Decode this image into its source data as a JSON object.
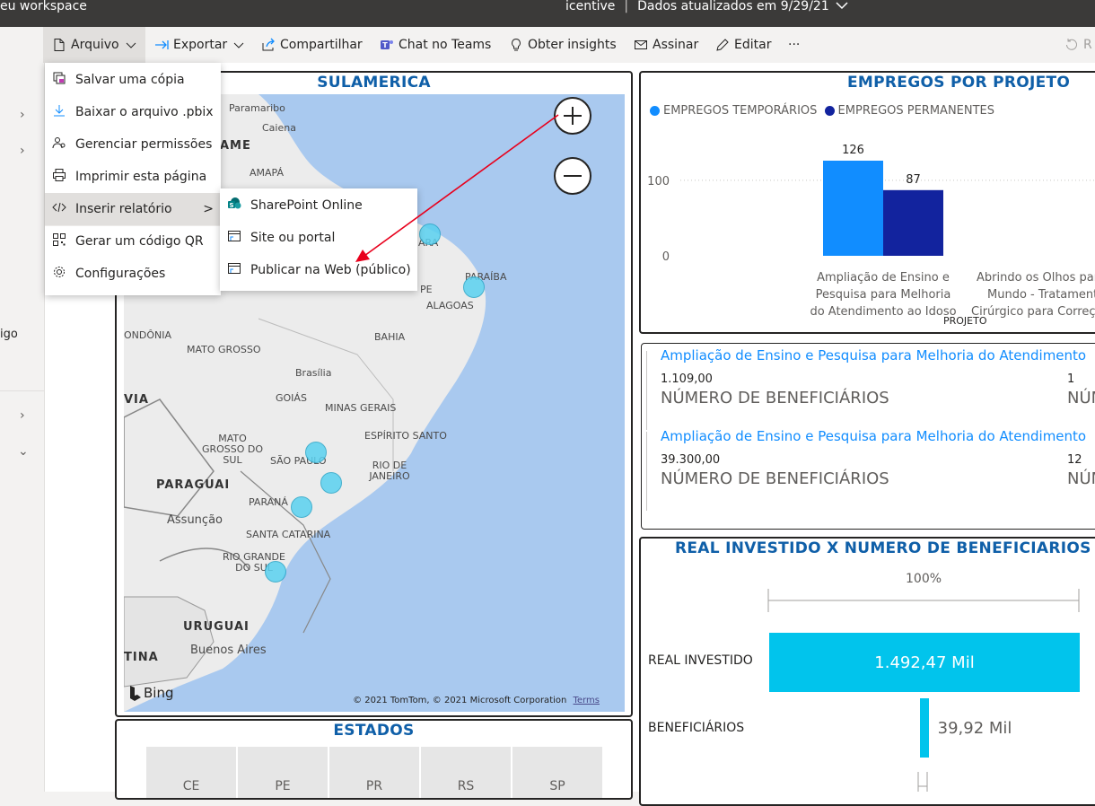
{
  "topbar": {
    "workspace": "eu workspace",
    "report_name": "icentive",
    "separator": "|",
    "updated": "Dados atualizados em 9/29/21",
    "chevron": "chevron-down-icon"
  },
  "toolbar": {
    "arquivo": "Arquivo",
    "exportar": "Exportar",
    "compartilhar": "Compartilhar",
    "teams": "Chat no Teams",
    "insights": "Obter insights",
    "assinar": "Assinar",
    "editar": "Editar",
    "more": "···",
    "reset_fragment": "R"
  },
  "left_pane": {
    "text_fragment": "igo"
  },
  "file_menu": {
    "items": [
      {
        "label": "Salvar uma cópia",
        "icon": "copy-icon"
      },
      {
        "label": "Baixar o arquivo .pbix",
        "icon": "download-icon"
      },
      {
        "label": "Gerenciar permissões",
        "icon": "permissions-icon"
      },
      {
        "label": "Imprimir esta página",
        "icon": "print-icon"
      },
      {
        "label": "Inserir relatório",
        "icon": "embed-icon",
        "submenu_arrow": ">"
      },
      {
        "label": "Gerar um código QR",
        "icon": "qr-code-icon"
      },
      {
        "label": "Configurações",
        "icon": "gear-icon"
      }
    ]
  },
  "embed_submenu": {
    "items": [
      {
        "label": "SharePoint Online",
        "icon": "sharepoint-icon"
      },
      {
        "label": "Site ou portal",
        "icon": "website-icon"
      },
      {
        "label": "Publicar na Web (público)",
        "icon": "publish-web-icon"
      }
    ]
  },
  "map_visual": {
    "title": "SULAMERICA",
    "labels": {
      "paramaribo": "Paramaribo",
      "caiena": "Caiena",
      "ame": "AME",
      "amapa": "AMAPÁ",
      "ara": "ARA",
      "paraiba": "PARAÍBA",
      "pe": "PE",
      "alagoas": "ALAGOAS",
      "ondonia": "ONDÔNIA",
      "mato_grosso": "MATO GROSSO",
      "bahia": "BAHIA",
      "brasilia": "Brasília",
      "goias": "GOIÁS",
      "minas": "MINAS GERAIS",
      "via": "VIA",
      "espirito": "ESPÍRITO SANTO",
      "ms": "MATO GROSSO DO SUL",
      "sao_paulo": "SÃO PAULO",
      "rio": "RIO DE JANEIRO",
      "paraguai": "PARAGUAI",
      "parana": "PARANÁ",
      "assuncao": "Assunção",
      "santa_catarina": "SANTA CATARINA",
      "rio_grande": "RIO GRANDE DO SUL",
      "uruguai": "URUGUAI",
      "buenos_aires": "Buenos Aires",
      "tina": "TINA",
      "bing": "Bing",
      "copyright": "© 2021 TomTom, © 2021 Microsoft Corporation",
      "terms": "Terms"
    }
  },
  "jobs_visual": {
    "title": "EMPREGOS POR PROJETO",
    "xlabel": "PROJETO",
    "legend": [
      "EMPREGOS TEMPORÁRIOS",
      "EMPREGOS PERMANENTES"
    ],
    "colors": {
      "temp": "#118dff",
      "perm": "#12239e"
    },
    "cat1_lines": [
      "Ampliação de Ensino e",
      "Pesquisa para Melhoria",
      "do Atendimento ao Idoso"
    ],
    "cat2_lines": [
      "Abrindo os Olhos par",
      "Mundo - Tratament",
      "Cirúrgico para Correç"
    ]
  },
  "kpi_visual": {
    "rows": [
      {
        "title": "Ampliação de Ensino e Pesquisa para Melhoria do Atendimento",
        "value": "1.109,00",
        "label": "NÚMERO DE BENEFICIÁRIOS",
        "value2": "1",
        "label2": "NÚM"
      },
      {
        "title": "Ampliação de Ensino e Pesquisa para Melhoria do Atendimento",
        "value": "39.300,00",
        "label": "NÚMERO DE BENEFICIÁRIOS",
        "value2": "12",
        "label2": "NÚM"
      }
    ]
  },
  "funnel_visual": {
    "title": "REAL INVESTIDO X NUMERO DE BENEFICIARIOS",
    "top_pct": "100%",
    "rows": [
      {
        "label": "REAL INVESTIDO",
        "value_text": "1.492,47 Mil",
        "value": 1492.47
      },
      {
        "label": "BENEFICIÁRIOS",
        "value_text": "39,92 Mil",
        "value": 39.92
      }
    ],
    "color": "#01c4ec"
  },
  "states_visual": {
    "title": "ESTADOS",
    "states": [
      "CE",
      "PE",
      "PR",
      "RS",
      "SP"
    ]
  },
  "chart_data": {
    "type": "bar",
    "title": "EMPREGOS POR PROJETO",
    "xlabel": "PROJETO",
    "ylabel": "",
    "categories": [
      "Ampliação de Ensino e Pesquisa para Melhoria do Atendimento ao Idoso",
      "Abrindo os Olhos par Mundo - Tratament Cirúrgico para Correç"
    ],
    "series": [
      {
        "name": "EMPREGOS TEMPORÁRIOS",
        "values": [
          126,
          0
        ]
      },
      {
        "name": "EMPREGOS PERMANENTES",
        "values": [
          87,
          2
        ]
      }
    ],
    "yticks": [
      0,
      100
    ],
    "ylim": [
      0,
      126
    ],
    "legend": "top-left",
    "grid": true
  }
}
